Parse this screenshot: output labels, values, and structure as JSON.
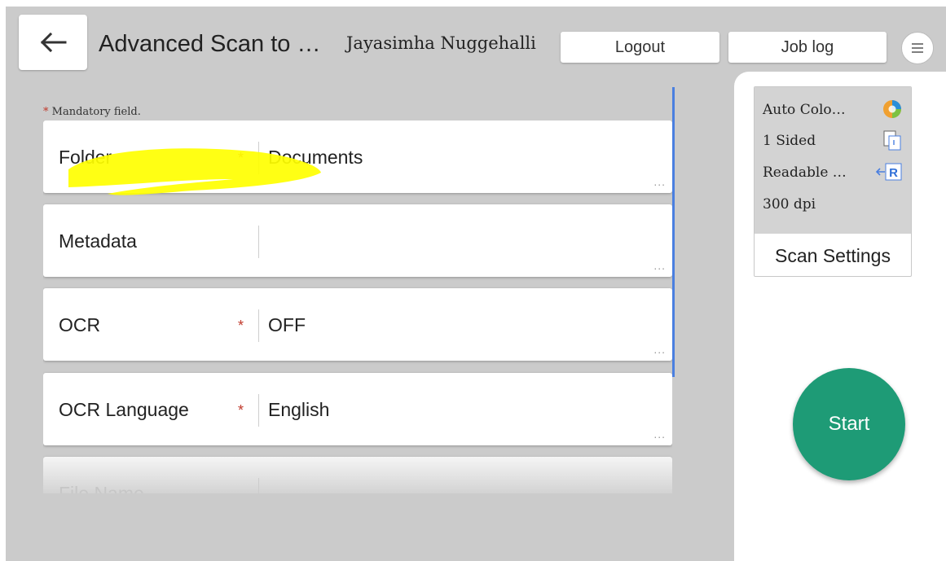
{
  "header": {
    "title": "Advanced Scan to …",
    "user_name": "Jayasimha Nuggehalli",
    "logout_label": "Logout",
    "job_log_label": "Job log"
  },
  "form": {
    "mandatory_star": "*",
    "mandatory_note": "Mandatory field.",
    "more_glyph": "...",
    "fields": [
      {
        "label": "Folder",
        "required": true,
        "value": "Documents"
      },
      {
        "label": "Metadata",
        "required": false,
        "value": ""
      },
      {
        "label": "OCR",
        "required": true,
        "value": "OFF"
      },
      {
        "label": "OCR Language",
        "required": true,
        "value": "English"
      },
      {
        "label": "File Name",
        "required": false,
        "value": ""
      }
    ]
  },
  "scan_settings": {
    "color_mode": "Auto Colo…",
    "sides": "1 Sided",
    "orientation": "Readable …",
    "resolution": "300 dpi",
    "button_label": "Scan Settings",
    "orientation_icon_letter": "R"
  },
  "actions": {
    "start_label": "Start"
  },
  "colors": {
    "accent_start": "#1e9b76",
    "required_star": "#c0392b",
    "scrollbar": "#4a7fe0",
    "highlight": "#ffff00"
  }
}
